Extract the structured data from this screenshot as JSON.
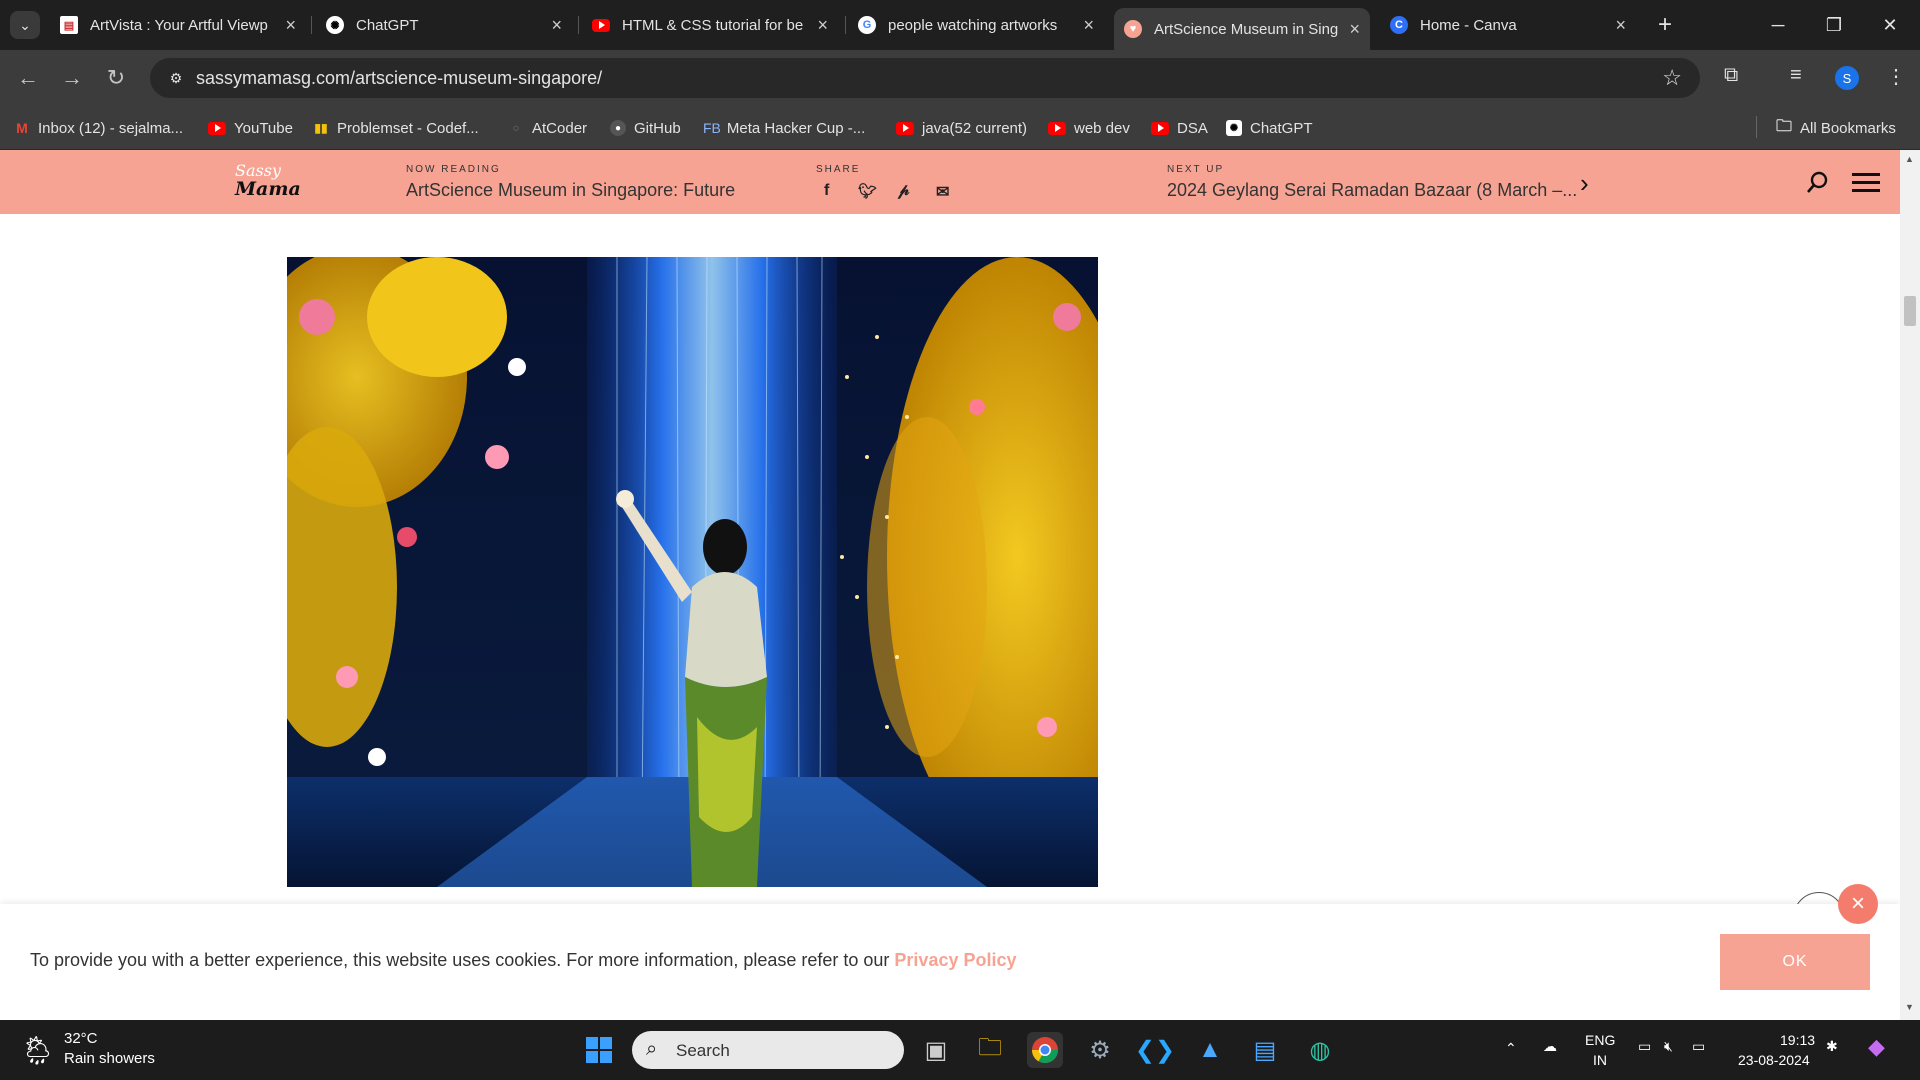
{
  "tabs": [
    {
      "title": "ArtVista : Your Artful Viewp",
      "favicon": "document-icon",
      "active": false
    },
    {
      "title": "ChatGPT",
      "favicon": "chatgpt-icon",
      "active": false
    },
    {
      "title": "HTML & CSS tutorial for be",
      "favicon": "youtube-icon",
      "active": false
    },
    {
      "title": "people watching artworks",
      "favicon": "google-icon",
      "active": false
    },
    {
      "title": "ArtScience Museum in Sing",
      "favicon": "sassymama-icon",
      "active": true
    },
    {
      "title": "Home - Canva",
      "favicon": "canva-icon",
      "active": false
    }
  ],
  "address": {
    "url": "sassymamasg.com/artscience-museum-singapore/"
  },
  "profile_initial": "S",
  "bookmarks": [
    {
      "label": "Inbox (12) - sejalma...",
      "icon": "gmail-icon"
    },
    {
      "label": "YouTube",
      "icon": "youtube-icon"
    },
    {
      "label": "Problemset - Codef...",
      "icon": "codeforces-icon"
    },
    {
      "label": "AtCoder",
      "icon": "atcoder-icon"
    },
    {
      "label": "GitHub",
      "icon": "github-icon"
    },
    {
      "label": "Meta Hacker Cup -...",
      "icon": "fb-icon",
      "prefix": "FB"
    },
    {
      "label": "java(52 current)",
      "icon": "youtube-icon"
    },
    {
      "label": "web dev",
      "icon": "youtube-icon"
    },
    {
      "label": "DSA",
      "icon": "youtube-icon"
    },
    {
      "label": "ChatGPT",
      "icon": "chatgpt-icon"
    }
  ],
  "all_bookmarks": "All Bookmarks",
  "site": {
    "logo_top": "Sassy",
    "logo_bottom": "Mama",
    "now_reading_label": "NOW READING",
    "now_reading": "ArtScience Museum in Singapore: Future",
    "share_label": "SHARE",
    "next_up_label": "NEXT UP",
    "next_up": "2024 Geylang Serai Ramadan Bazaar (8 March –..."
  },
  "cookie": {
    "text": "To provide you with a better experience, this website uses cookies. For more information, please refer to our ",
    "link": "Privacy Policy",
    "ok": "OK"
  },
  "taskbar": {
    "temp": "32°C",
    "weather": "Rain showers",
    "search": "Search",
    "lang1": "ENG",
    "lang2": "IN",
    "time": "19:13",
    "date": "23-08-2024"
  }
}
